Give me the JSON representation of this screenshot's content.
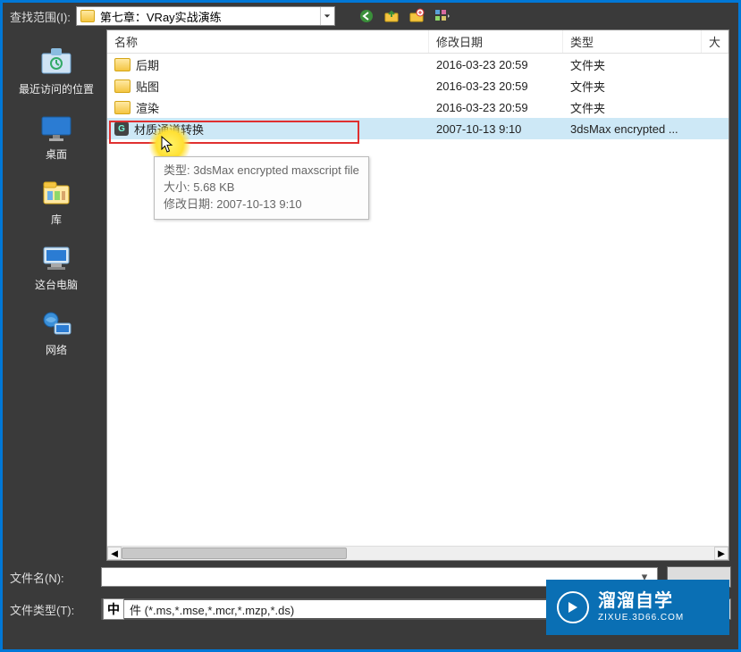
{
  "topbar": {
    "label": "查找范围(I):",
    "path": "第七章：VRay实战演练"
  },
  "sidebar": {
    "items": [
      {
        "label": "最近访问的位置"
      },
      {
        "label": "桌面"
      },
      {
        "label": "库"
      },
      {
        "label": "这台电脑"
      },
      {
        "label": "网络"
      }
    ]
  },
  "columns": {
    "name": "名称",
    "date": "修改日期",
    "type": "类型",
    "size": "大"
  },
  "rows": [
    {
      "name": "后期",
      "date": "2016-03-23 20:59",
      "type": "文件夹",
      "kind": "folder"
    },
    {
      "name": "贴图",
      "date": "2016-03-23 20:59",
      "type": "文件夹",
      "kind": "folder"
    },
    {
      "name": "渲染",
      "date": "2016-03-23 20:59",
      "type": "文件夹",
      "kind": "folder"
    },
    {
      "name": "材质通道转换",
      "date": "2007-10-13 9:10",
      "type": "3dsMax encrypted ...",
      "kind": "script",
      "selected": true
    }
  ],
  "tooltip": {
    "line1": "类型: 3dsMax encrypted maxscript file",
    "line2": "大小: 5.68 KB",
    "line3": "修改日期: 2007-10-13 9:10"
  },
  "bottom": {
    "filename_label": "文件名(N):",
    "filename_value": "",
    "filetype_label": "文件类型(T):",
    "ime": "中",
    "filetype_value": "件 (*.ms,*.mse,*.mcr,*.mzp,*.ds)"
  },
  "watermark": {
    "big": "溜溜自学",
    "small": "ZIXUE.3D66.COM"
  }
}
